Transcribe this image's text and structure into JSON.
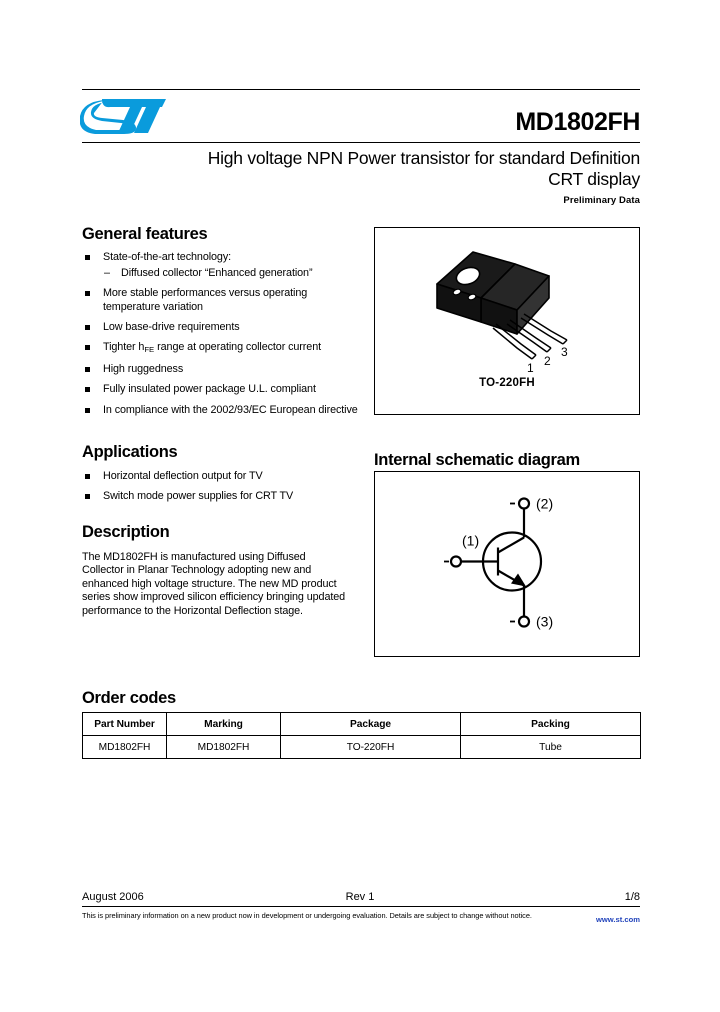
{
  "header": {
    "logo_alt": "ST",
    "logo_color": "#0a9bdc",
    "part_number": "MD1802FH",
    "subtitle": "High voltage NPN Power transistor for standard Definition CRT display",
    "preliminary": "Preliminary Data"
  },
  "general_features": {
    "heading": "General features",
    "items": [
      {
        "text": "State-of-the-art technology:",
        "sub": "Diffused collector “Enhanced generation”"
      },
      {
        "text": "More stable performances versus operating temperature variation"
      },
      {
        "text": "Low base-drive requirements"
      },
      {
        "text_before": "Tighter h",
        "subscript": "FE",
        "text_after": " range at operating collector current"
      },
      {
        "text": "High ruggedness"
      },
      {
        "text": "Fully insulated power package U.L. compliant"
      },
      {
        "text": "In compliance with the 2002/93/EC European directive"
      }
    ]
  },
  "applications": {
    "heading": "Applications",
    "items": [
      {
        "text": "Horizontal deflection output for TV"
      },
      {
        "text": "Switch mode power supplies for CRT TV"
      }
    ]
  },
  "description": {
    "heading": "Description",
    "text": "The MD1802FH is manufactured using Diffused Collector in Planar Technology adopting new and enhanced high voltage structure. The new MD product series show improved silicon efficiency bringing updated performance to the Horizontal Deflection stage."
  },
  "package": {
    "caption": "TO-220FH",
    "pin_labels": [
      "1",
      "2",
      "3"
    ]
  },
  "schematic": {
    "heading": "Internal schematic diagram",
    "terminals": [
      {
        "label": "(1)",
        "role": "base"
      },
      {
        "label": "(2)",
        "role": "collector"
      },
      {
        "label": "(3)",
        "role": "emitter"
      }
    ]
  },
  "order_codes": {
    "heading": "Order codes",
    "columns": [
      "Part Number",
      "Marking",
      "Package",
      "Packing"
    ],
    "rows": [
      [
        "MD1802FH",
        "MD1802FH",
        "TO-220FH",
        "Tube"
      ]
    ]
  },
  "footer": {
    "date": "August 2006",
    "revision": "Rev 1",
    "page": "1/8",
    "disclaimer": "This is preliminary information on a new product now in development or undergoing evaluation. Details are subject to change without notice.",
    "website": "www.st.com",
    "website_color": "#2244bb"
  }
}
